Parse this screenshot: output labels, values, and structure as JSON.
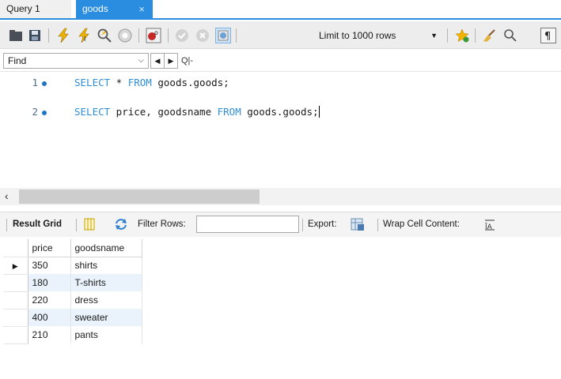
{
  "tabs": [
    {
      "label": "Query 1"
    },
    {
      "label": "goods",
      "close": "×"
    }
  ],
  "toolbar": {
    "limit_label": "Limit to 1000 rows",
    "colors": {
      "accent": "#2a8de0",
      "keyword": "#2f8fd6"
    }
  },
  "findbar": {
    "find_value": "Find",
    "mode_label": "Q|-"
  },
  "editor": {
    "lines": [
      {
        "number": "1",
        "kw1": "SELECT",
        "text1": " * ",
        "kw2": "FROM",
        "text2": " goods.goods;"
      },
      {
        "number": "2",
        "kw1": "SELECT",
        "text1": " price, goodsname ",
        "kw2": "FROM",
        "text2": " goods.goods;"
      }
    ]
  },
  "resultbar": {
    "result_grid": "Result Grid",
    "filter_rows": "Filter Rows:",
    "export": "Export:",
    "wrap": "Wrap Cell Content:"
  },
  "grid": {
    "columns": [
      "price",
      "goodsname"
    ],
    "rows": [
      {
        "price": "350",
        "goodsname": "shirts"
      },
      {
        "price": "180",
        "goodsname": "T-shirts"
      },
      {
        "price": "220",
        "goodsname": "dress"
      },
      {
        "price": "400",
        "goodsname": "sweater"
      },
      {
        "price": "210",
        "goodsname": "pants"
      }
    ]
  }
}
